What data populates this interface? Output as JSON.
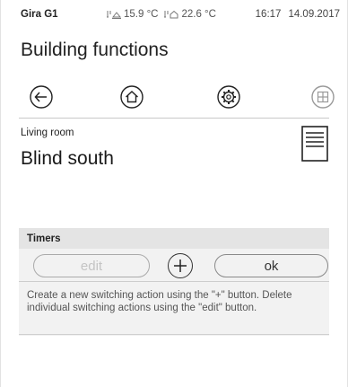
{
  "status_bar": {
    "device_name": "Gira G1",
    "outdoor_temp": "15.9 °C",
    "indoor_temp": "22.6 °C",
    "time": "16:17",
    "date": "14.09.2017"
  },
  "header": {
    "title": "Building functions"
  },
  "nav": {
    "icons": [
      "back-arrow-icon",
      "home-icon",
      "settings-icon",
      "grid-icon"
    ]
  },
  "function": {
    "room": "Living room",
    "name": "Blind south",
    "icon": "blind-icon"
  },
  "timers": {
    "header": "Timers",
    "edit_label": "edit",
    "ok_label": "ok",
    "help_text": "Create a new switching action using the \"+\" button. Delete individual switching actions using the \"edit\" button."
  }
}
